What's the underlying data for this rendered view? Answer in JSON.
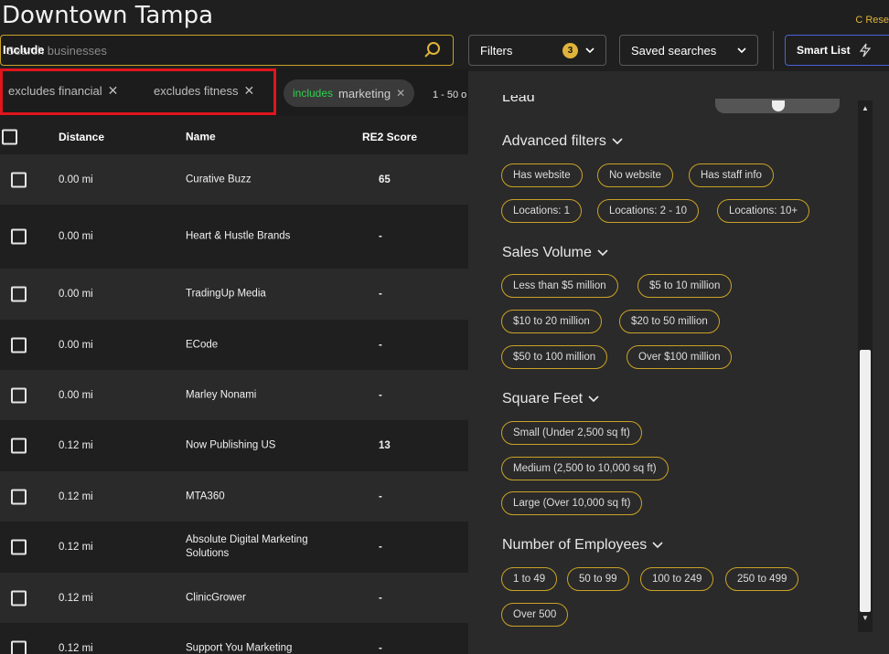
{
  "header": {
    "title": "Downtown Tampa",
    "reset_label": "C Rese"
  },
  "search": {
    "placeholder": "Search businesses",
    "prefix": "Include"
  },
  "toolbar": {
    "filters_label": "Filters",
    "filters_count": "3",
    "saved_label": "Saved searches",
    "smart_label": "Smart List"
  },
  "chips": {
    "excludes": [
      {
        "label": "excludes financial"
      },
      {
        "label": "excludes fitness"
      }
    ],
    "include_keyword": "includes",
    "include_value": "marketing",
    "count_text": "1 - 50 o"
  },
  "table": {
    "headers": {
      "distance": "Distance",
      "name": "Name",
      "score": "RE2 Score"
    },
    "rows": [
      {
        "distance": "0.00 mi",
        "name": "Curative Buzz",
        "score": "65"
      },
      {
        "distance": "0.00 mi",
        "name": "Heart & Hustle Brands",
        "score": "-"
      },
      {
        "distance": "0.00 mi",
        "name": "TradingUp Media",
        "score": "-"
      },
      {
        "distance": "0.00 mi",
        "name": "ECode",
        "score": "-"
      },
      {
        "distance": "0.00 mi",
        "name": "Marley Nonami",
        "score": "-"
      },
      {
        "distance": "0.12 mi",
        "name": "Now Publishing US",
        "score": "13"
      },
      {
        "distance": "0.12 mi",
        "name": "MTA360",
        "score": "-"
      },
      {
        "distance": "0.12 mi",
        "name": "Absolute Digital Marketing Solutions",
        "score": "-"
      },
      {
        "distance": "0.12 mi",
        "name": "ClinicGrower",
        "score": "-"
      },
      {
        "distance": "0.12 mi",
        "name": "Support You Marketing",
        "score": "-"
      }
    ]
  },
  "panel": {
    "lead_label": "Lead",
    "advanced": {
      "title": "Advanced filters",
      "pills": [
        "Has website",
        "No website",
        "Has staff info",
        "Locations: 1",
        "Locations: 2 - 10",
        "Locations: 10+"
      ]
    },
    "sales": {
      "title": "Sales Volume",
      "pills": [
        "Less than $5 million",
        "$5 to 10 million",
        "$10 to 20 million",
        "$20 to 50 million",
        "$50 to 100 million",
        "Over $100 million"
      ]
    },
    "sqft": {
      "title": "Square Feet",
      "pills": [
        "Small (Under 2,500 sq ft)",
        "Medium (2,500 to 10,000 sq ft)",
        "Large (Over 10,000 sq ft)"
      ]
    },
    "employees": {
      "title": "Number of Employees",
      "pills": [
        "1 to 49",
        "50 to 99",
        "100 to 249",
        "250 to 499",
        "Over 500"
      ]
    }
  },
  "colors": {
    "accent": "#e0b43a",
    "include_green": "#2ed14d",
    "highlight_red": "#e0151d",
    "smart_blue": "#4a63d8"
  }
}
